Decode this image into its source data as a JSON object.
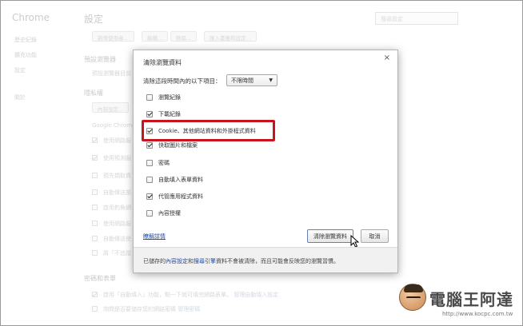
{
  "background": {
    "brand": "Chrome",
    "nav": [
      "歷史紀錄",
      "擴充功能",
      "設定",
      "關於"
    ],
    "page_title": "設定",
    "search_placeholder": "搜尋設定",
    "top_buttons": [
      "新增使用者...",
      "編輯...",
      "移除...",
      "匯入書籤和設定..."
    ],
    "default_browser_heading": "預設瀏覽器",
    "default_browser_text": "預設瀏覽器目前",
    "privacy_heading": "隱私權",
    "content_settings_button": "內容設定...",
    "google_chrome_text": "Google Chrome",
    "privacy_items": [
      {
        "label": "使用網路服",
        "checked": true
      },
      {
        "label": "使用預測服",
        "checked": true
      },
      {
        "label": "預先擷取資",
        "checked": false
      },
      {
        "label": "自動傳送部",
        "checked": false
      },
      {
        "label": "啟用釣魚網",
        "checked": false
      },
      {
        "label": "使用網路服",
        "checked": false
      },
      {
        "label": "自動傳送使",
        "checked": false
      },
      {
        "label": "將「不追蹤",
        "checked": false
      }
    ],
    "passwords_heading": "密碼和表單",
    "autofill_text": "啟用「自動填入」功能，點一下就可填完網路表單。",
    "autofill_link": "管理自動填入設定",
    "passwords_text": "詢問是否要儲存您的網路密碼",
    "passwords_link": "管理密碼"
  },
  "dialog": {
    "title": "清除瀏覽資料",
    "close_glyph": "×",
    "range_label": "清除這段時間內的以下項目：",
    "range_selected": "不限時間",
    "options": [
      {
        "label": "瀏覽紀錄",
        "checked": false
      },
      {
        "label": "下載紀錄",
        "checked": true
      },
      {
        "label": "Cookie、其他網站資料和外掛程式資料",
        "checked": true
      },
      {
        "label": "快取圖片和檔案",
        "checked": true
      },
      {
        "label": "密碼",
        "checked": false
      },
      {
        "label": "自動填入表單資料",
        "checked": false
      },
      {
        "label": "代管應用程式資料",
        "checked": true
      },
      {
        "label": "內容授權",
        "checked": false
      }
    ],
    "learn_more": "瞭解詳情",
    "clear_button": "清除瀏覽資料",
    "cancel_button": "取消",
    "footer_prefix": "已儲存的",
    "footer_link1": "內容設定",
    "footer_and": "和",
    "footer_link2": "搜尋引擎",
    "footer_suffix": "資料不會被清除，而且可能會反映您的瀏覽習慣。"
  },
  "watermark": {
    "name": "電腦王阿達",
    "url": "http://www.kocpc.com.tw"
  }
}
